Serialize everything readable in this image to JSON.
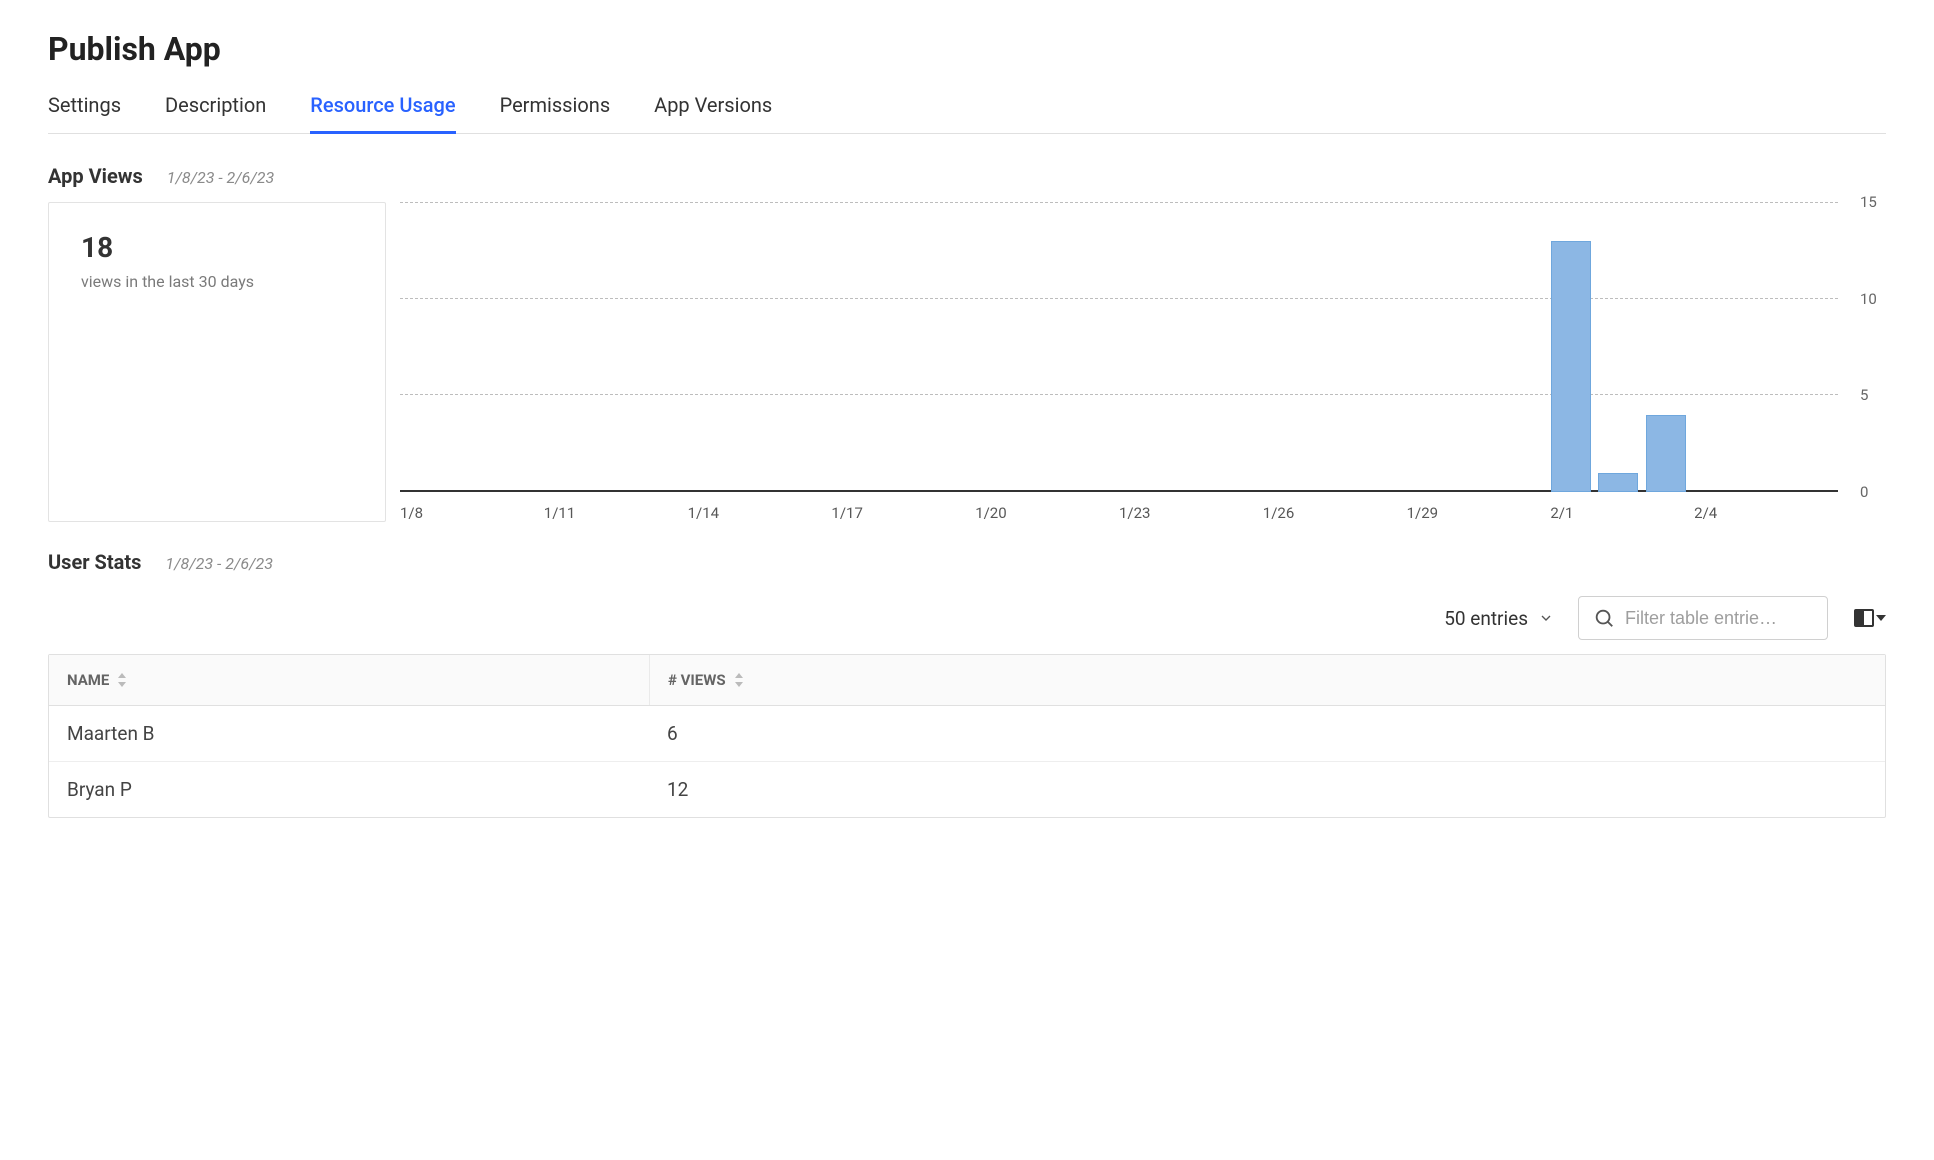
{
  "page_title": "Publish App",
  "tabs": [
    {
      "label": "Settings"
    },
    {
      "label": "Description"
    },
    {
      "label": "Resource Usage",
      "active": true
    },
    {
      "label": "Permissions"
    },
    {
      "label": "App Versions"
    }
  ],
  "app_views": {
    "section_title": "App Views",
    "date_range": "1/8/23 - 2/6/23",
    "stat_number": "18",
    "stat_sub": "views in the last 30 days"
  },
  "chart_data": {
    "type": "bar",
    "categories": [
      "1/8",
      "1/9",
      "1/10",
      "1/11",
      "1/12",
      "1/13",
      "1/14",
      "1/15",
      "1/16",
      "1/17",
      "1/18",
      "1/19",
      "1/20",
      "1/21",
      "1/22",
      "1/23",
      "1/24",
      "1/25",
      "1/26",
      "1/27",
      "1/28",
      "1/29",
      "1/30",
      "1/31",
      "2/1",
      "2/2",
      "2/3",
      "2/4",
      "2/5",
      "2/6"
    ],
    "values": [
      0,
      0,
      0,
      0,
      0,
      0,
      0,
      0,
      0,
      0,
      0,
      0,
      0,
      0,
      0,
      0,
      0,
      0,
      0,
      0,
      0,
      0,
      0,
      0,
      13,
      1,
      4,
      0,
      0,
      0
    ],
    "x_ticks": [
      "1/8",
      "1/11",
      "1/14",
      "1/17",
      "1/20",
      "1/23",
      "1/26",
      "1/29",
      "2/1",
      "2/4"
    ],
    "y_ticks": [
      0,
      5,
      10,
      15
    ],
    "ylim": [
      0,
      15
    ],
    "title": "",
    "xlabel": "",
    "ylabel": ""
  },
  "user_stats": {
    "section_title": "User Stats",
    "date_range": "1/8/23 - 2/6/23",
    "entries_label": "50 entries",
    "filter_placeholder": "Filter table entrie…",
    "columns": [
      "NAME",
      "# VIEWS"
    ],
    "rows": [
      {
        "name": "Maarten B",
        "views": "6"
      },
      {
        "name": "Bryan P",
        "views": "12"
      }
    ]
  }
}
